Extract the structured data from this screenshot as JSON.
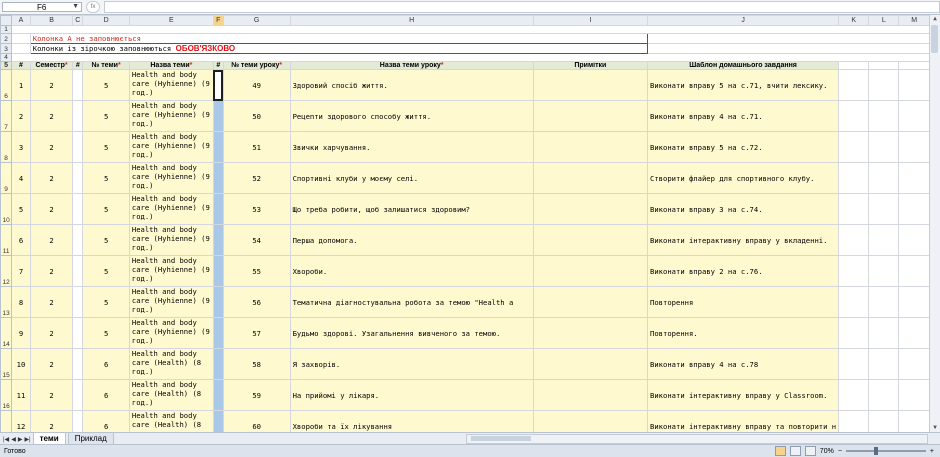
{
  "formula_bar": {
    "name_box": "F6",
    "fx": "fx",
    "formula": ""
  },
  "columns": [
    "A",
    "B",
    "C",
    "D",
    "E",
    "F",
    "G",
    "H",
    "I",
    "J",
    "K",
    "L",
    "M"
  ],
  "active_column": "F",
  "notes": {
    "row2": "Колонка А не заповнюється",
    "row3_text": "Колонки із зірочкою заповнюються",
    "row3_bold": "ОБОВ'ЯЗКОВО"
  },
  "headers": {
    "a": "#",
    "b": "Семестр",
    "c": "#",
    "d": "№ теми",
    "e": "Назва теми",
    "f": "#",
    "g": "№ теми уроку",
    "h": "Назва теми уроку",
    "i": "Примітки",
    "j": "Шаблон домашнього завдання",
    "star": "*"
  },
  "rows": [
    {
      "rownum": "6",
      "a": "1",
      "b": "2",
      "d": "5",
      "e": "Health and body care (Hyhienne) (9 год.)",
      "g": "49",
      "h": "Здоровий спосіб життя.",
      "j": "Виконати вправу 5 на с.71, вчити лексику."
    },
    {
      "rownum": "7",
      "a": "2",
      "b": "2",
      "d": "5",
      "e": "Health and body care (Hyhienne) (9 год.)",
      "g": "50",
      "h": "Рецепти здорового способу життя.",
      "j": "Виконати вправу 4 на с.71."
    },
    {
      "rownum": "8",
      "a": "3",
      "b": "2",
      "d": "5",
      "e": "Health and body care (Hyhienne) (9 год.)",
      "g": "51",
      "h": "Звички харчування.",
      "j": "Виконати вправу 5 на с.72."
    },
    {
      "rownum": "9",
      "a": "4",
      "b": "2",
      "d": "5",
      "e": "Health and body care (Hyhienne) (9 год.)",
      "g": "52",
      "h": "Спортивні клуби у моєму селі.",
      "j": "Створити флайер для спортивного клубу."
    },
    {
      "rownum": "10",
      "a": "5",
      "b": "2",
      "d": "5",
      "e": "Health and body care (Hyhienne) (9 год.)",
      "g": "53",
      "h": "Що треба робити, щоб залишатися здоровим?",
      "j": "Виконати вправу 3 на с.74."
    },
    {
      "rownum": "11",
      "a": "6",
      "b": "2",
      "d": "5",
      "e": "Health and body care (Hyhienne) (9 год.)",
      "g": "54",
      "h": "Перша допомога.",
      "j": "Виконати інтерактивну вправу у вкладенні."
    },
    {
      "rownum": "12",
      "a": "7",
      "b": "2",
      "d": "5",
      "e": "Health and body care (Hyhienne) (9 год.)",
      "g": "55",
      "h": "Хвороби.",
      "j": "Виконати вправу 2 на с.76."
    },
    {
      "rownum": "13",
      "a": "8",
      "b": "2",
      "d": "5",
      "e": "Health and body care (Hyhienne) (9 год.)",
      "g": "56",
      "h": "Тематична діагностувальна робота за темою \"Health a",
      "j": "Повторення"
    },
    {
      "rownum": "14",
      "a": "9",
      "b": "2",
      "d": "5",
      "e": "Health and body care (Hyhienne) (9 год.)",
      "g": "57",
      "h": "Будьмо здорові. Узагальнення вивченого за темою.",
      "j": "Повторення."
    },
    {
      "rownum": "15",
      "a": "10",
      "b": "2",
      "d": "6",
      "e": "Health and body care (Health) (8 год.)",
      "g": "58",
      "h": "Я захворів.",
      "j": "Виконати вправу 4 на с.78"
    },
    {
      "rownum": "16",
      "a": "11",
      "b": "2",
      "d": "6",
      "e": "Health and body care (Health) (8 год.)",
      "g": "59",
      "h": "На прийомі у лікаря.",
      "j": "Виконати інтерактивну вправу у Classroom."
    },
    {
      "rownum": "17",
      "a": "12",
      "b": "2",
      "d": "6",
      "e": "Health and body care (Health) (8",
      "g": "60",
      "h": "Хвороби та їх лікування",
      "j": "Виконати інтерактивну вправу та повторити н"
    }
  ],
  "sheet_tabs": [
    "теми",
    "Приклад"
  ],
  "active_tab": "теми",
  "status": {
    "ready": "Готово",
    "zoom": "70%",
    "zoom_minus": "−",
    "zoom_plus": "+"
  }
}
